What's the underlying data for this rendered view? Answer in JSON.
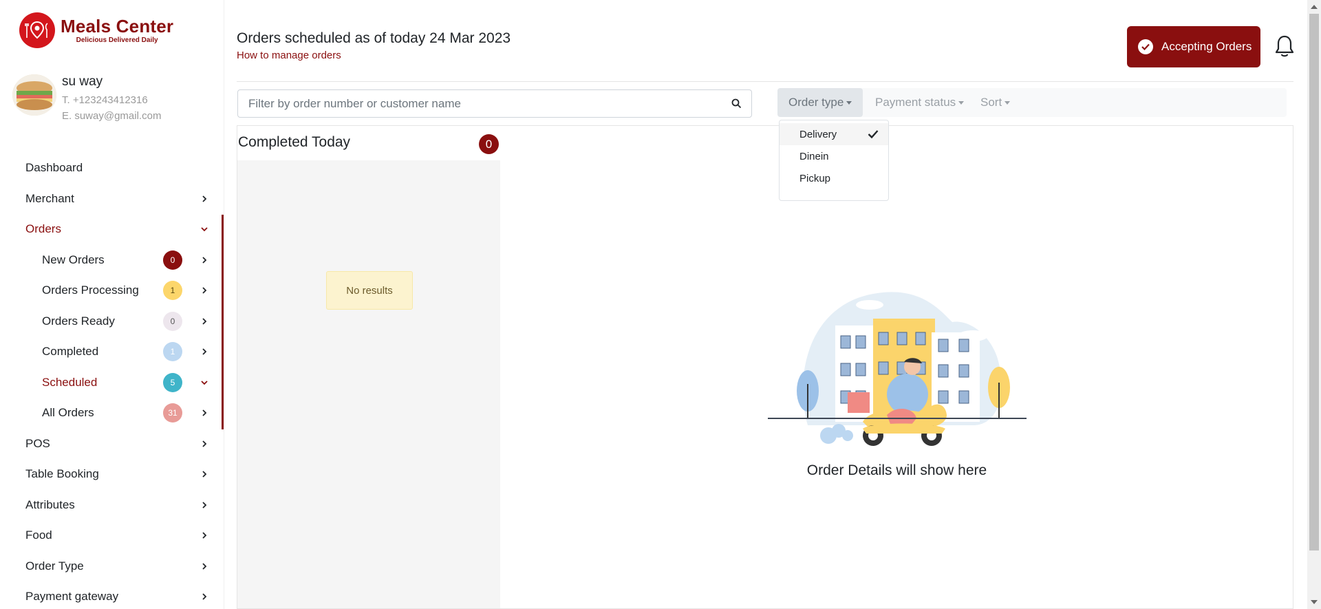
{
  "brand": {
    "title": "Meals Center",
    "subtitle": "Delicious Delivered Daily",
    "color": "#8a0f0f"
  },
  "profile": {
    "name": "su way",
    "phone": "T. +123243412316",
    "email": "E. suway@gmail.com"
  },
  "nav": {
    "dashboard": "Dashboard",
    "merchant": "Merchant",
    "orders": "Orders",
    "new_orders": {
      "label": "New Orders",
      "count": "0"
    },
    "orders_processing": {
      "label": "Orders Processing",
      "count": "1"
    },
    "orders_ready": {
      "label": "Orders Ready",
      "count": "0"
    },
    "completed": {
      "label": "Completed",
      "count": "1"
    },
    "scheduled": {
      "label": "Scheduled",
      "count": "5"
    },
    "all_orders": {
      "label": "All Orders",
      "count": "31"
    },
    "pos": "POS",
    "table_booking": "Table Booking",
    "attributes": "Attributes",
    "food": "Food",
    "order_type": "Order Type",
    "payment_gateway": "Payment gateway"
  },
  "header": {
    "title": "Orders scheduled as of today 24 Mar 2023",
    "howto": "How to manage orders",
    "accept_label": "Accepting Orders"
  },
  "search": {
    "placeholder": "Filter by order number or customer name"
  },
  "filters": {
    "order_type": "Order type",
    "payment_status": "Payment status",
    "sort": "Sort",
    "order_type_options": [
      "Delivery",
      "Dinein",
      "Pickup"
    ],
    "selected": "Delivery"
  },
  "completed_panel": {
    "title": "Completed Today",
    "count": "0",
    "empty": "No results"
  },
  "details_panel": {
    "placeholder": "Order Details will show here"
  }
}
